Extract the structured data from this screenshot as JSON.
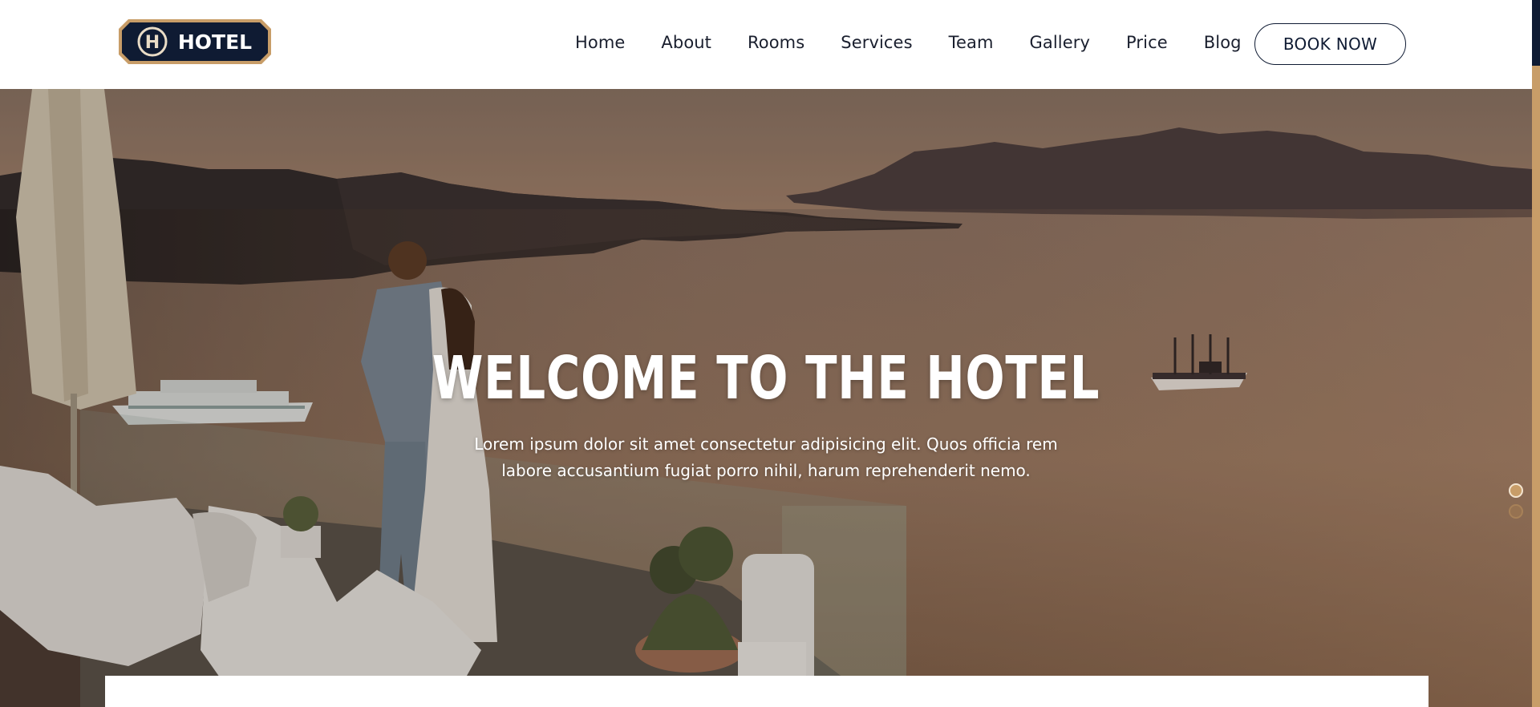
{
  "logo": {
    "text": "HOTEL",
    "letter": "H"
  },
  "nav": {
    "items": [
      {
        "label": "Home"
      },
      {
        "label": "About"
      },
      {
        "label": "Rooms"
      },
      {
        "label": "Services"
      },
      {
        "label": "Team"
      },
      {
        "label": "Gallery"
      },
      {
        "label": "Price"
      },
      {
        "label": "Blog"
      }
    ],
    "cta_label": "BOOK NOW"
  },
  "hero": {
    "title": "WELCOME TO THE HOTEL",
    "subtitle_line1": "Lorem ipsum dolor sit amet consectetur adipisicing elit. Quos officia rem",
    "subtitle_line2": "labore accusantium fugiat porro nihil, harum reprehenderit nemo.",
    "slides_total": 2,
    "slide_active": 1
  },
  "colors": {
    "navy": "#0f1b33",
    "gold": "#c89d68",
    "nav_text": "#1a1f2e"
  }
}
